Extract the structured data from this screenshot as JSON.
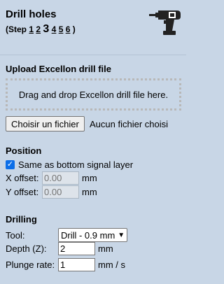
{
  "header": {
    "title": "Drill holes",
    "steps_open": "(Step",
    "steps": [
      "1",
      "2",
      "3",
      "4",
      "5",
      "6"
    ],
    "current_step": "3",
    "steps_close": ")",
    "icon": "drill-icon"
  },
  "upload": {
    "title": "Upload Excellon drill file",
    "dropzone_text": "Drag and drop Excellon drill file here.",
    "button_label": "Choisir un fichier",
    "status": "Aucun fichier choisi"
  },
  "position": {
    "title": "Position",
    "same_as_label": "Same as bottom signal layer",
    "same_as_checked": true,
    "x_label": "X offset:",
    "x_placeholder": "0.00",
    "x_unit": "mm",
    "y_label": "Y offset:",
    "y_placeholder": "0.00",
    "y_unit": "mm"
  },
  "drilling": {
    "title": "Drilling",
    "tool_label": "Tool:",
    "tool_value": "Drill - 0.9 mm",
    "depth_label": "Depth (Z):",
    "depth_value": "2",
    "depth_unit": "mm",
    "plunge_label": "Plunge rate:",
    "plunge_value": "1",
    "plunge_unit": "mm / s"
  }
}
